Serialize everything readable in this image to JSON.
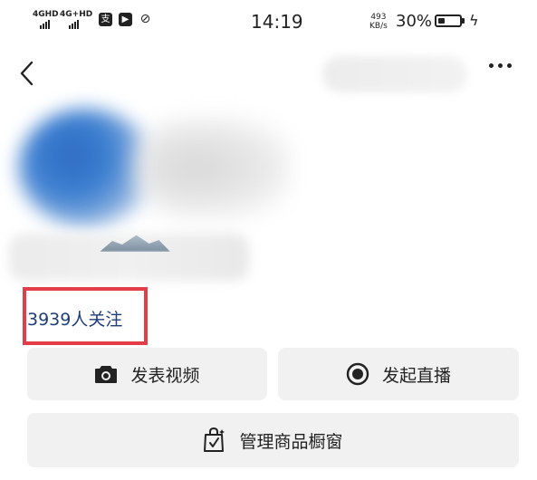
{
  "status_bar": {
    "network1": "4GHD",
    "network2": "4G+HD",
    "app_icon_1": "支",
    "time": "14:19",
    "speed_value": "493",
    "speed_unit": "KB/s",
    "battery_percent": "30%",
    "battery_level": 0.3
  },
  "profile": {
    "followers_text": "3939人关注"
  },
  "actions": {
    "post_video": "发表视频",
    "start_live": "发起直播",
    "manage_showcase": "管理商品橱窗"
  },
  "icons": {
    "back": "chevron-left-icon",
    "more": "more-horizontal-icon",
    "camera": "camera-icon",
    "live": "record-icon",
    "bag": "shopping-bag-icon"
  },
  "colors": {
    "followers": "#1e3e78",
    "highlight_box": "#e33d4a",
    "button_bg": "#f1f1f1"
  }
}
